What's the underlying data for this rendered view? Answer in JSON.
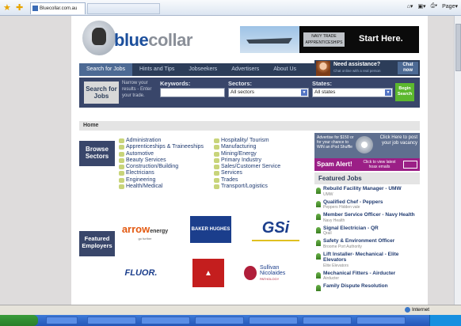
{
  "browser": {
    "tab_title": "Bluecollar.com.au",
    "toolbar_page": "Page",
    "status_zone": "Internet"
  },
  "site": {
    "logo_text_blue": "blue",
    "logo_text_gray": "collar",
    "banner": {
      "badge": "NAVY TRADE APPRENTICESHIPS",
      "cta": "Start Here."
    },
    "nav": [
      {
        "label": "Search for Jobs",
        "active": true
      },
      {
        "label": "Hints and Tips"
      },
      {
        "label": "Jobseekers"
      },
      {
        "label": "Advertisers"
      },
      {
        "label": "About Us"
      }
    ],
    "assist": {
      "title": "Need assistance?",
      "subtitle": "Chat online with a real person",
      "chat_label": "Chat now"
    },
    "search": {
      "title": "Search for Jobs",
      "narrow": "Narrow your results - Enter your trade.",
      "keywords_label": "Keywords:",
      "keywords_value": "",
      "sectors_label": "Sectors:",
      "sectors_value": "All sectors",
      "states_label": "States:",
      "states_value": "All states",
      "begin_label": "Begin Search"
    },
    "breadcrumb": "Home",
    "browse_title": "Browse Sectors",
    "sectors_left": [
      "Administration",
      "Apprenticeships & Traineeships",
      "Automotive",
      "Beauty Services",
      "Construction/Building",
      "Electricians",
      "Engineering",
      "Health/Medical"
    ],
    "sectors_right": [
      "Hospitality/ Tourism",
      "Manufacturing",
      "Mining/Energy",
      "Primary Industry",
      "Sales/Customer Service",
      "Services",
      "Trades",
      "Transport/Logistics"
    ],
    "featured_employers_title": "Featured Employers",
    "employers": {
      "arrow": "arrow",
      "arrow_sub": "energy",
      "arrow_tag": "go further",
      "baker": "BAKER HUGHES",
      "gsi": "GSi",
      "fluor": "FLUOR.",
      "sullivan": "Sullivan Nicolaides",
      "sullivan_sub": "PATHOLOGY"
    },
    "ipod_ad": {
      "left": "Advertise for $150 or for your chance to WIN an iPod Shuffle",
      "right": "Click Here to post your job vacancy"
    },
    "spam_alert": {
      "title": "Spam Alert!",
      "text": "Click to view latest hoax emails"
    },
    "featured_jobs_title": "Featured Jobs",
    "jobs": [
      {
        "title": "Rebuild Facility Manager - UMW",
        "company": "UMW"
      },
      {
        "title": "Qualified Chef - Peppers",
        "company": "Peppers Hidden vale"
      },
      {
        "title": "Member Service Officer - Navy Health",
        "company": "Navy Health"
      },
      {
        "title": "Signal Electrician - QR",
        "company": "Qrail"
      },
      {
        "title": "Safety & Environment Officer",
        "company": "Broome Port Authority"
      },
      {
        "title": "Lift Installer- Mechanical - Elite Elevators",
        "company": "Elite Elevators"
      },
      {
        "title": "Mechanical Fitters - Airducter",
        "company": "Airducter"
      },
      {
        "title": "Family Dispute Resolution",
        "company": ""
      }
    ]
  }
}
